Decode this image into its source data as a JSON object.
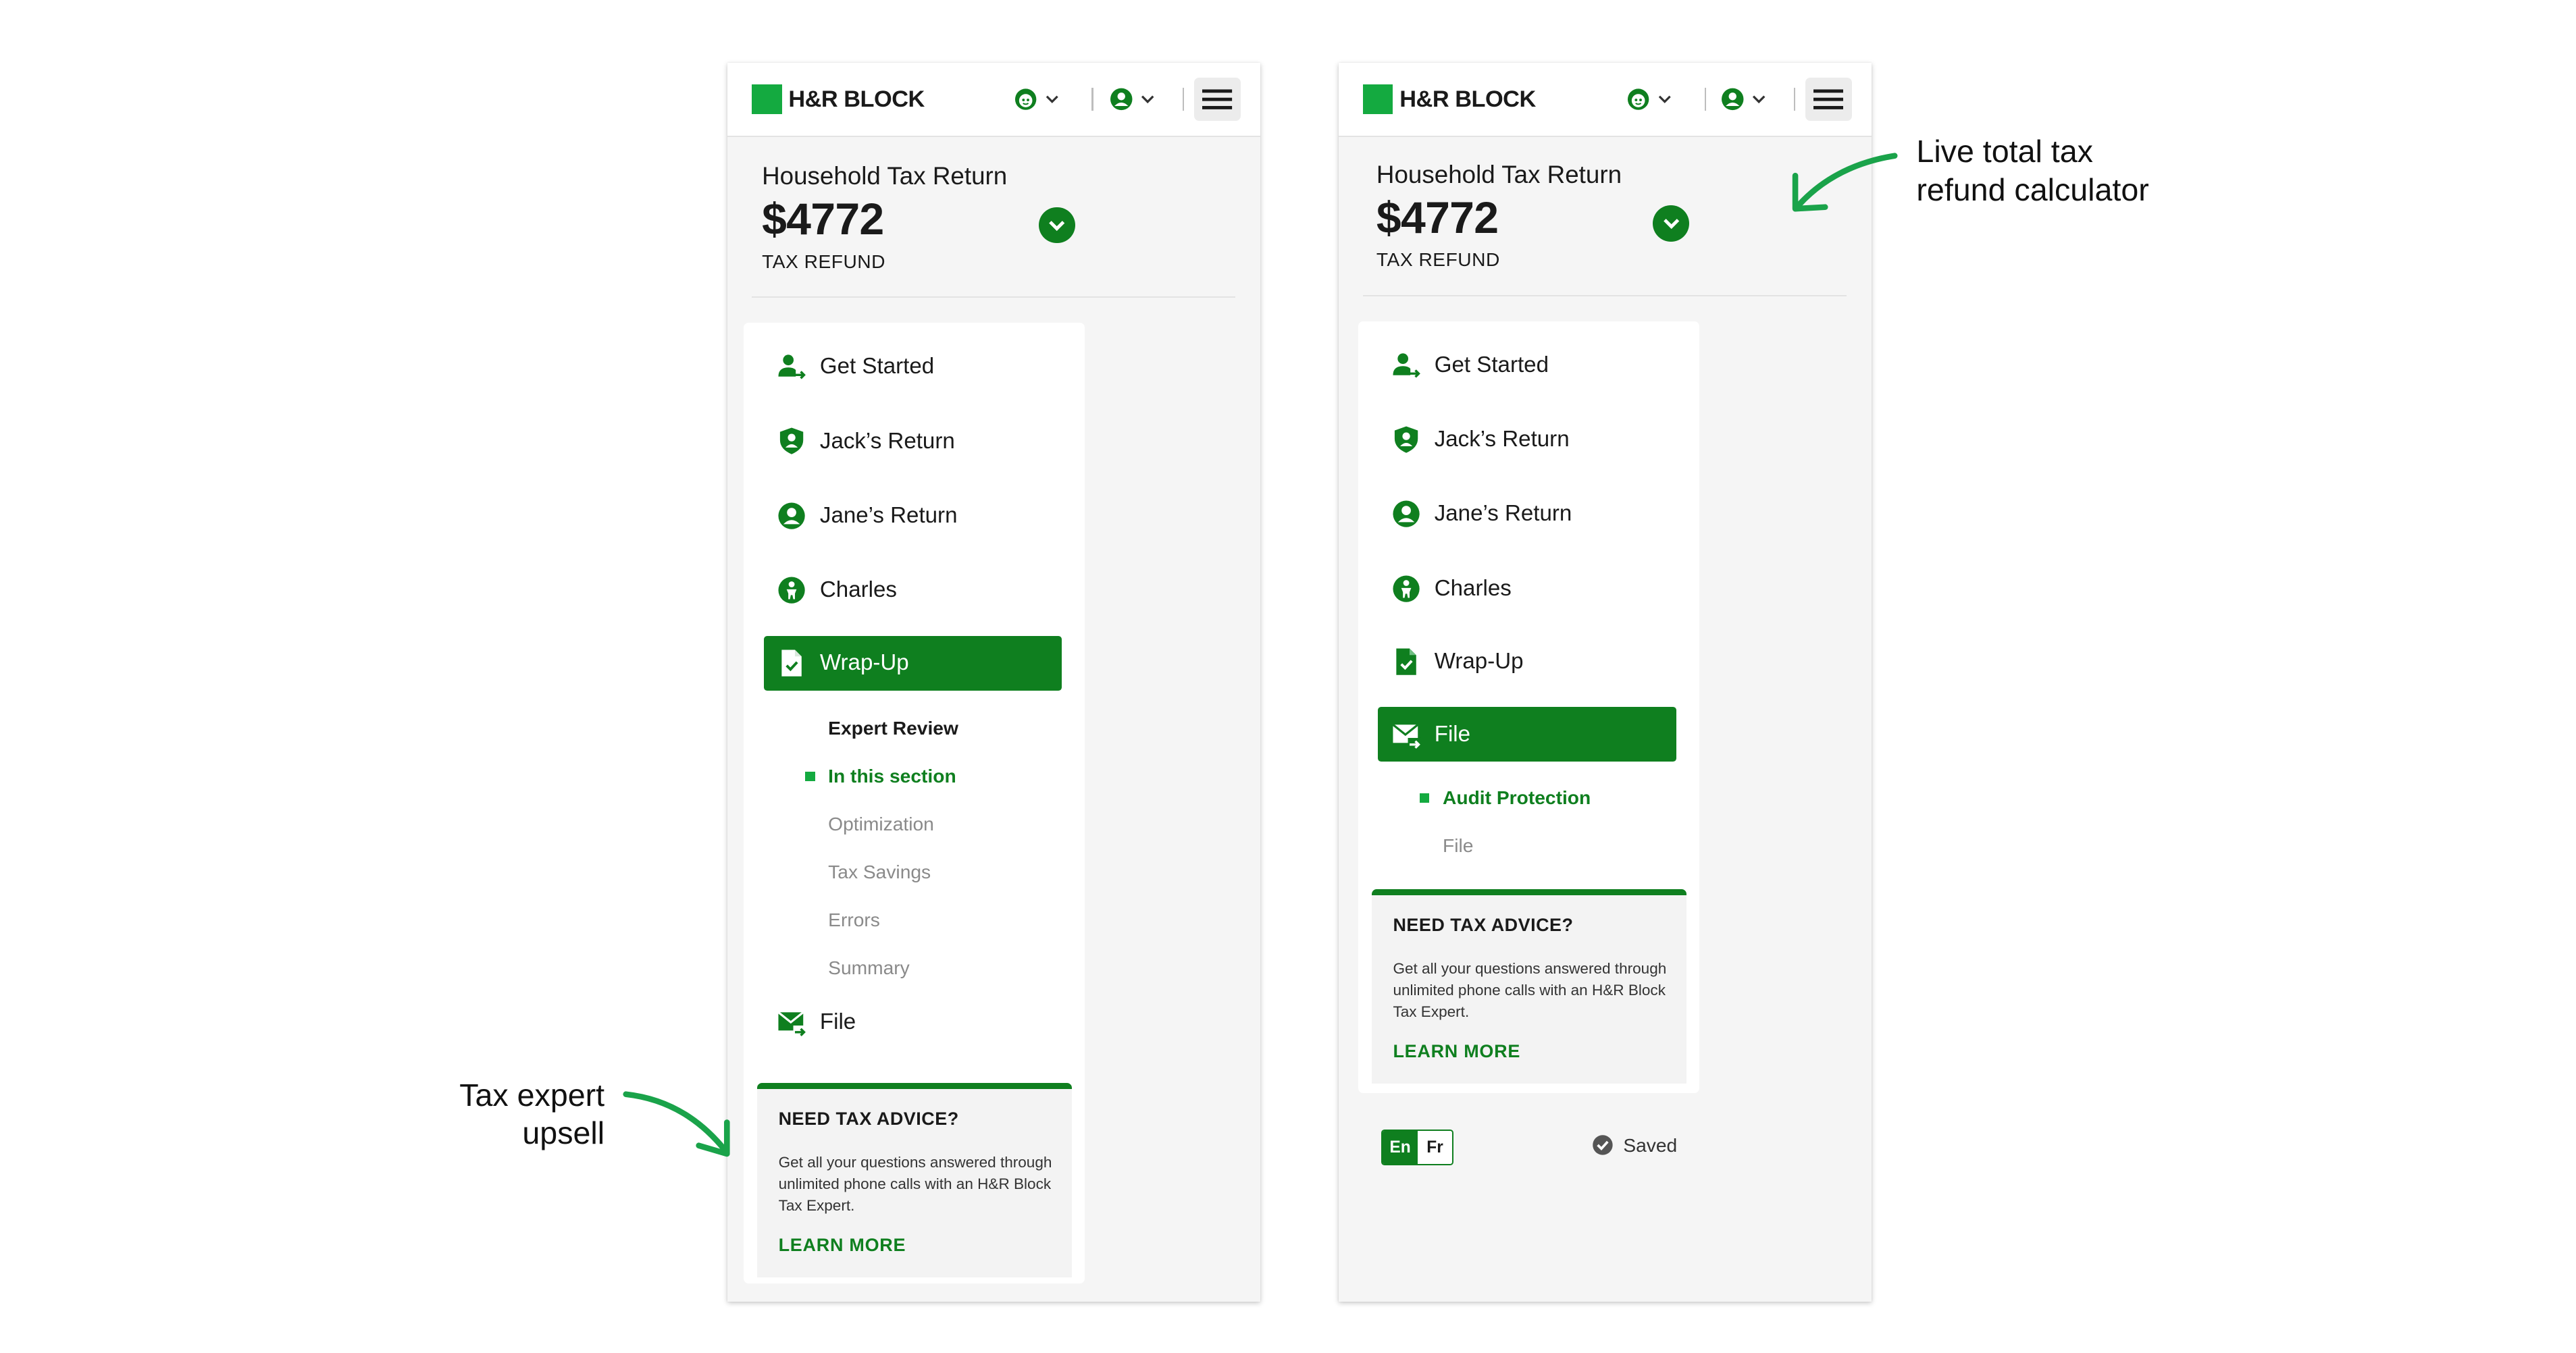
{
  "colors": {
    "brand_green": "#14aa40",
    "dark_green": "#0f7f1f",
    "panel_bg": "#f5f5f5"
  },
  "panels": [
    {
      "brand": {
        "name": "H&R BLOCK"
      },
      "summary": {
        "title": "Household Tax Return",
        "amount": "$4772",
        "label": "TAX REFUND"
      },
      "nav": [
        {
          "label": "Get Started",
          "icon": "person-arrow-icon"
        },
        {
          "label": "Jack’s Return",
          "icon": "shield-person-icon"
        },
        {
          "label": "Jane’s Return",
          "icon": "person-circle-icon"
        },
        {
          "label": "Charles",
          "icon": "child-icon"
        },
        {
          "label": "Wrap-Up",
          "icon": "document-check-icon",
          "active": true
        },
        {
          "label": "File",
          "icon": "mail-send-icon"
        }
      ],
      "subnav": {
        "current": "Expert Review",
        "items": [
          "In this section",
          "Optimization",
          "Tax Savings",
          "Errors",
          "Summary"
        ]
      },
      "advice": {
        "title": "NEED TAX ADVICE?",
        "body": "Get all your questions answered through unlimited phone calls with an H&R Block Tax Expert.",
        "link": "LEARN MORE"
      }
    },
    {
      "brand": {
        "name": "H&R BLOCK"
      },
      "summary": {
        "title": "Household Tax Return",
        "amount": "$4772",
        "label": "TAX REFUND"
      },
      "nav": [
        {
          "label": "Get Started",
          "icon": "person-arrow-icon"
        },
        {
          "label": "Jack’s Return",
          "icon": "shield-person-icon"
        },
        {
          "label": "Jane’s Return",
          "icon": "person-circle-icon"
        },
        {
          "label": "Charles",
          "icon": "child-icon"
        },
        {
          "label": "Wrap-Up",
          "icon": "document-check-icon"
        },
        {
          "label": "File",
          "icon": "mail-send-icon",
          "active": true
        }
      ],
      "subnav": {
        "items": [
          "Audit Protection",
          "File"
        ]
      },
      "advice": {
        "title": "NEED TAX ADVICE?",
        "body": "Get all your questions answered through unlimited phone calls with an H&R Block Tax Expert.",
        "link": "LEARN MORE"
      },
      "footer": {
        "lang_en": "En",
        "lang_fr": "Fr",
        "saved": "Saved"
      }
    }
  ],
  "annotations": {
    "left": [
      "Tax expert",
      "upsell"
    ],
    "right": [
      "Live total tax",
      "refund calculator"
    ]
  }
}
